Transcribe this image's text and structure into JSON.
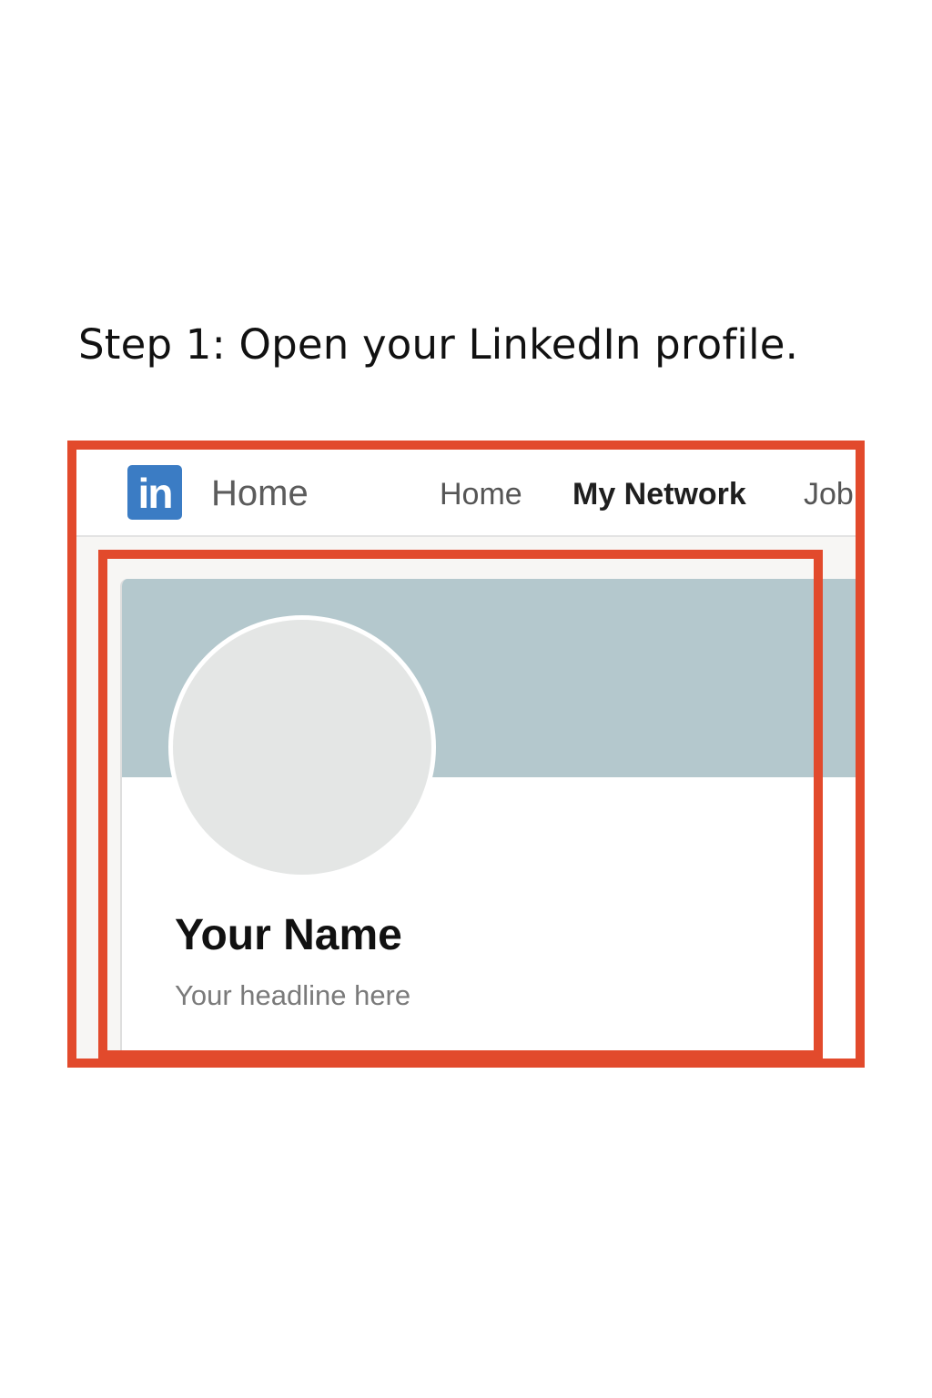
{
  "instruction": {
    "step_text": "Step 1: Open your LinkedIn profile."
  },
  "screenshot": {
    "navbar": {
      "logo_text": "in",
      "logo_color": "#3b7cc4",
      "title": "Home",
      "items": [
        {
          "label": "Home"
        },
        {
          "label": "My Network"
        },
        {
          "label": "Job"
        }
      ]
    },
    "profile": {
      "cover_color": "#b4c8cd",
      "name": "Your Name",
      "headline": "Your headline here"
    }
  },
  "highlight_color": "#e24a2c"
}
